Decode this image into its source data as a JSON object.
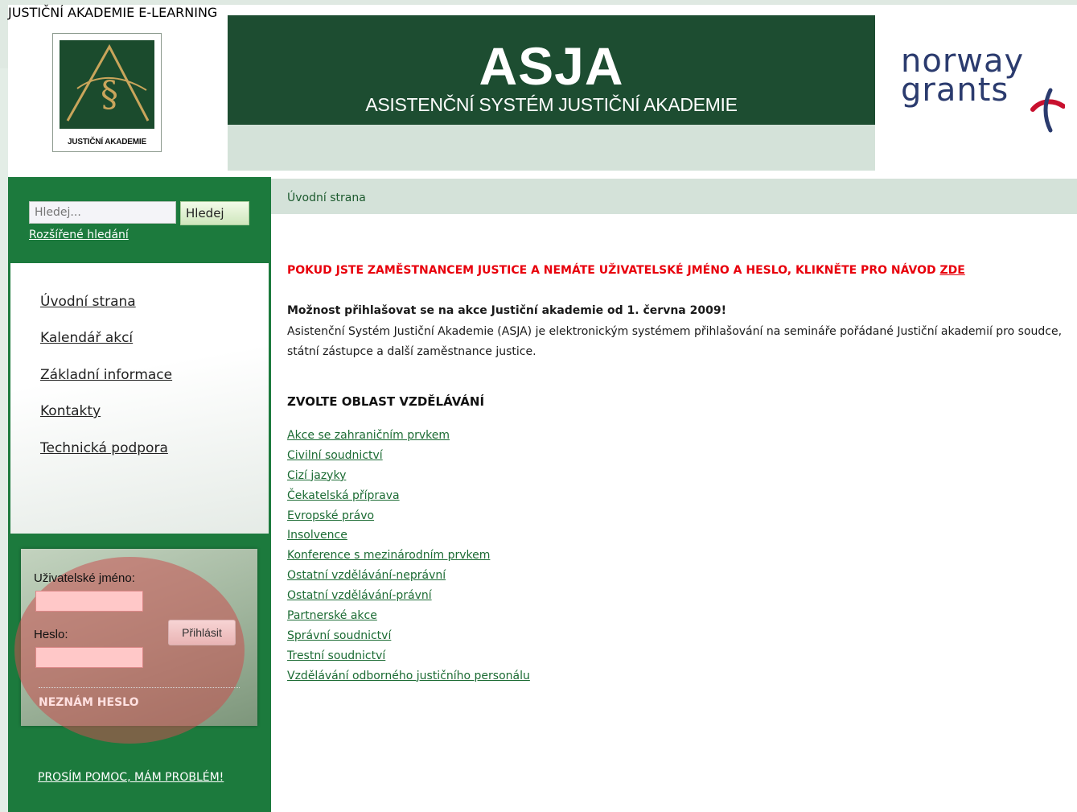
{
  "header": {
    "logo_text": "JUSTIČNÍ AKADEMIE",
    "banner_title": "ASJA",
    "banner_subtitle": "ASISTENČNÍ SYSTÉM JUSTIČNÍ AKADEMIE",
    "nav": [
      "JUSTIČNÍ AKADEMIE",
      "E-LEARNING"
    ],
    "sponsor_line1": "norway",
    "sponsor_line2": "grants"
  },
  "sidebar": {
    "search_placeholder": "Hledej...",
    "search_button": "Hledej",
    "advanced_search": "Rozšířené hledání",
    "menu": [
      "Úvodní strana",
      "Kalendář akcí",
      "Základní informace",
      "Kontakty",
      "Technická podpora"
    ],
    "login": {
      "username_label": "Uživatelské jméno:",
      "password_label": "Heslo:",
      "login_button": "Přihlásit",
      "forgot": "NEZNÁM HESLO"
    },
    "help_link": "PROSÍM POMOC, MÁM PROBLÉM!"
  },
  "breadcrumb": "Úvodní strana",
  "main": {
    "alert_text": "POKUD JSTE ZAMĚSTNANCEM JUSTICE A NEMÁTE UŽIVATELSKÉ JMÉNO A HESLO, KLIKNĚTE PRO NÁVOD",
    "alert_link": "ZDE",
    "intro_heading": "Možnost přihlašovat se na akce Justiční akademie od 1. června 2009!",
    "intro_body": "Asistenční Systém Justiční Akademie (ASJA) je elektronickým systémem přihlašování na semináře pořádané Justiční akademií pro soudce, státní zástupce a další zaměstnance justice.",
    "section_title": "ZVOLTE OBLAST VZDĚLÁVÁNÍ",
    "categories": [
      "Akce se zahraničním prvkem",
      "Civilní soudnictví",
      "Cizí jazyky",
      "Čekatelská příprava",
      "Evropské právo",
      "Insolvence",
      "Konference s mezinárodním prvkem",
      "Ostatní vzdělávání-neprávní",
      "Ostatní vzdělávání-právní",
      "Partnerské akce",
      "Správní soudnictví",
      "Trestní soudnictví",
      "Vzdělávání odborného justičního personálu"
    ]
  },
  "colors": {
    "banner_green": "#1d4d31",
    "sidebar_green": "#1c7a3d",
    "nav_bar": "#d4e2d9",
    "alert_red": "#e8000c",
    "link_green": "#1b6b33",
    "norway_blue": "#2b3b6e",
    "norway_red": "#c8102e"
  }
}
